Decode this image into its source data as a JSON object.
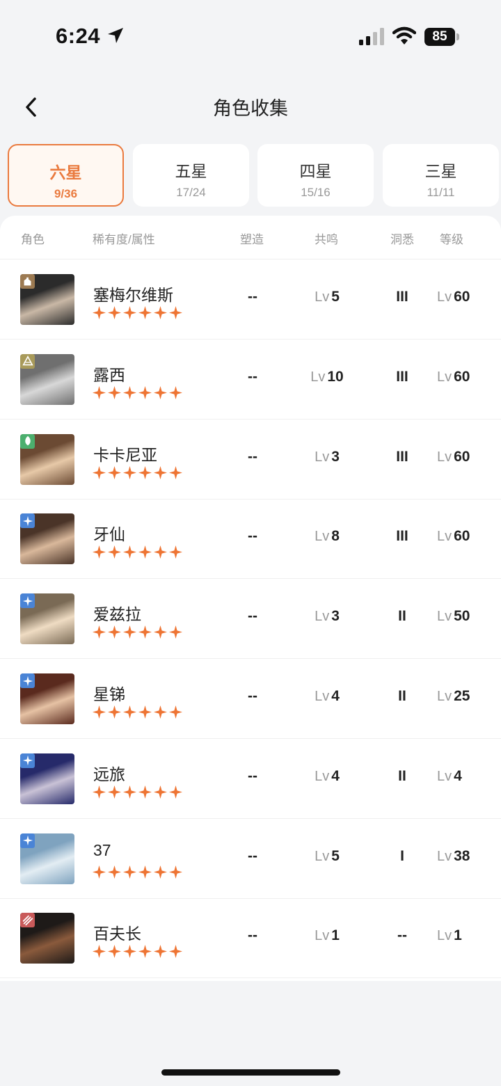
{
  "status": {
    "time": "6:24",
    "battery": "85"
  },
  "header": {
    "title": "角色收集"
  },
  "tabs": [
    {
      "label": "六星",
      "count": "9/36",
      "active": true
    },
    {
      "label": "五星",
      "count": "17/24",
      "active": false
    },
    {
      "label": "四星",
      "count": "15/16",
      "active": false
    },
    {
      "label": "三星",
      "count": "11/11",
      "active": false
    }
  ],
  "columns": {
    "role": "角色",
    "rarity": "稀有度/属性",
    "shape": "塑造",
    "resonance": "共鸣",
    "insight": "洞悉",
    "level": "等级"
  },
  "lv_prefix": "Lv",
  "characters": [
    {
      "name": "塞梅尔维斯",
      "attribute_icon": "tower-icon",
      "attribute_color": "#9c7a52",
      "stars": 6,
      "shape": "--",
      "resonance": "5",
      "insight": "III",
      "level": "60"
    },
    {
      "name": "露西",
      "attribute_icon": "pyramid-icon",
      "attribute_color": "#a89a5a",
      "stars": 6,
      "shape": "--",
      "resonance": "10",
      "insight": "III",
      "level": "60"
    },
    {
      "name": "卡卡尼亚",
      "attribute_icon": "leaf-icon",
      "attribute_color": "#4caf6e",
      "stars": 6,
      "shape": "--",
      "resonance": "3",
      "insight": "III",
      "level": "60"
    },
    {
      "name": "牙仙",
      "attribute_icon": "star-sparkle-icon",
      "attribute_color": "#4a84d6",
      "stars": 6,
      "shape": "--",
      "resonance": "8",
      "insight": "III",
      "level": "60"
    },
    {
      "name": "爱兹拉",
      "attribute_icon": "star-sparkle-icon",
      "attribute_color": "#4a84d6",
      "stars": 6,
      "shape": "--",
      "resonance": "3",
      "insight": "II",
      "level": "50"
    },
    {
      "name": "星锑",
      "attribute_icon": "star-sparkle-icon",
      "attribute_color": "#4a84d6",
      "stars": 6,
      "shape": "--",
      "resonance": "4",
      "insight": "II",
      "level": "25"
    },
    {
      "name": "远旅",
      "attribute_icon": "star-sparkle-icon",
      "attribute_color": "#4a84d6",
      "stars": 6,
      "shape": "--",
      "resonance": "4",
      "insight": "II",
      "level": "4"
    },
    {
      "name": "37",
      "attribute_icon": "star-sparkle-icon",
      "attribute_color": "#4a84d6",
      "stars": 6,
      "shape": "--",
      "resonance": "5",
      "insight": "I",
      "level": "38"
    },
    {
      "name": "百夫长",
      "attribute_icon": "claw-icon",
      "attribute_color": "#c95a5a",
      "stars": 6,
      "shape": "--",
      "resonance": "1",
      "insight": "--",
      "level": "1"
    }
  ],
  "colors": {
    "accent": "#ea7a3e",
    "star": "#ee7433"
  }
}
